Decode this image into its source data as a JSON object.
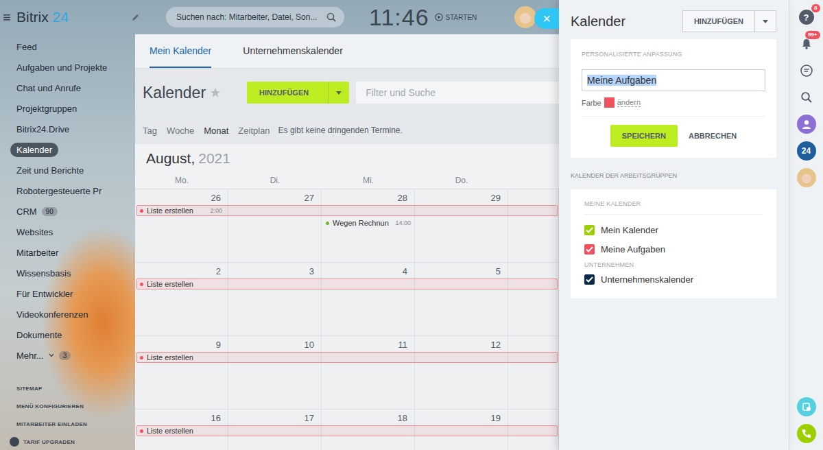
{
  "header": {
    "menu_icon": "≡",
    "logo": {
      "name": "Bitrix",
      "number": "24"
    },
    "search_placeholder": "Suchen nach: Mitarbeiter, Datei, Son...",
    "clock": "11:46",
    "start_label": "STARTEN"
  },
  "sidebar": {
    "items": [
      {
        "label": "Feed",
        "selected": false
      },
      {
        "label": "Aufgaben und Projekte",
        "selected": false
      },
      {
        "label": "Chat und Anrufe",
        "selected": false
      },
      {
        "label": "Projektgruppen",
        "selected": false
      },
      {
        "label": "Bitrix24.Drive",
        "selected": false
      },
      {
        "label": "Kalender",
        "selected": true
      },
      {
        "label": "Zeit und Berichte",
        "selected": false
      },
      {
        "label": "Robotergesteuerte Pr",
        "selected": false
      },
      {
        "label": "CRM",
        "selected": false,
        "badge": "90"
      },
      {
        "label": "Websites",
        "selected": false
      },
      {
        "label": "Mitarbeiter",
        "selected": false
      },
      {
        "label": "Wissensbasis",
        "selected": false
      },
      {
        "label": "Für Entwickler",
        "selected": false
      },
      {
        "label": "Videokonferenzen",
        "selected": false
      },
      {
        "label": "Dokumente",
        "selected": false
      },
      {
        "label": "Mehr...",
        "selected": false,
        "badge": "3",
        "has_menu": true
      }
    ],
    "links": [
      "SITEMAP",
      "MENÜ KONFIGURIEREN",
      "MITARBEITER EINLADEN"
    ],
    "upgrade": "TARIF UPGRADEN"
  },
  "calendar": {
    "tabs": [
      {
        "label": "Mein Kalender",
        "selected": true
      },
      {
        "label": "Unternehmenskalender",
        "selected": false
      }
    ],
    "title": "Kalender",
    "add_button": "HINZUFÜGEN",
    "filter_placeholder": "Filter und Suche",
    "views": [
      {
        "label": "Tag",
        "selected": false
      },
      {
        "label": "Woche",
        "selected": false
      },
      {
        "label": "Monat",
        "selected": true
      },
      {
        "label": "Zeitplan",
        "selected": false
      }
    ],
    "notice": "Es gibt keine dringenden Termine.",
    "month": "August,",
    "year": "2021",
    "weekdays": [
      "Mo.",
      "Di.",
      "Mi.",
      "Do."
    ],
    "weeks": [
      {
        "days": [
          {
            "number": "26",
            "events": [
              {
                "title": "Liste erstellen",
                "time": "2:00",
                "color": "#f0515c",
                "kind": "multi-day"
              }
            ]
          },
          {
            "number": "27",
            "events": []
          },
          {
            "number": "28",
            "events": [
              {
                "title": "Wegen Rechnun",
                "time": "14:00",
                "color": "#7bb52a",
                "kind": "single"
              }
            ]
          },
          {
            "number": "29",
            "events": []
          }
        ]
      },
      {
        "days": [
          {
            "number": "2",
            "events": [
              {
                "title": "Liste erstellen",
                "time": "",
                "color": "#f0515c",
                "kind": "multi-day"
              }
            ]
          },
          {
            "number": "3",
            "events": []
          },
          {
            "number": "4",
            "events": []
          },
          {
            "number": "5",
            "events": []
          }
        ]
      },
      {
        "days": [
          {
            "number": "9",
            "events": [
              {
                "title": "Liste erstellen",
                "time": "",
                "color": "#f0515c",
                "kind": "multi-day"
              }
            ]
          },
          {
            "number": "10",
            "events": []
          },
          {
            "number": "11",
            "events": []
          },
          {
            "number": "12",
            "events": []
          }
        ]
      },
      {
        "days": [
          {
            "number": "16",
            "events": [
              {
                "title": "Liste erstellen",
                "time": "",
                "color": "#f0515c",
                "kind": "multi-day"
              }
            ]
          },
          {
            "number": "17",
            "events": []
          },
          {
            "number": "18",
            "events": []
          },
          {
            "number": "19",
            "events": []
          }
        ]
      }
    ]
  },
  "panel": {
    "close": "×",
    "title": "Kalender",
    "add_button": "HINZUFÜGEN",
    "edit_card": {
      "label": "PERSONALISIERTE ANPASSUNG",
      "name_value": "Meine Aufgaben",
      "text_selected": true,
      "color_label": "Farbe",
      "color": "#f0515c",
      "change_link": "ändern",
      "save": "SPEICHERN",
      "cancel": "ABBRECHEN"
    },
    "groups_label": "KALENDER DER ARBEITSGRUPPEN",
    "calendars": {
      "title": "MEINE KALENDER",
      "items": [
        {
          "kind": "calendar",
          "label": "Mein Kalender",
          "checked": true,
          "color": "#9dcf00"
        },
        {
          "kind": "calendar",
          "label": "Meine Aufgaben",
          "checked": true,
          "color": "#f0515c"
        },
        {
          "kind": "heading",
          "label": "UNTERNEHMEN"
        },
        {
          "kind": "calendar",
          "label": "Unternehmenskalender",
          "checked": true,
          "color": "#0b2a4a"
        }
      ]
    }
  },
  "strip": {
    "top": [
      {
        "kind": "help",
        "glyph": "?",
        "badge": "8"
      },
      {
        "kind": "bell",
        "badge": "99+"
      },
      {
        "kind": "chat"
      },
      {
        "kind": "search"
      },
      {
        "kind": "profile"
      },
      {
        "kind": "bitrix",
        "glyph": "24"
      },
      {
        "kind": "avatar"
      }
    ],
    "bottom": [
      {
        "kind": "disk"
      },
      {
        "kind": "phone"
      }
    ]
  }
}
